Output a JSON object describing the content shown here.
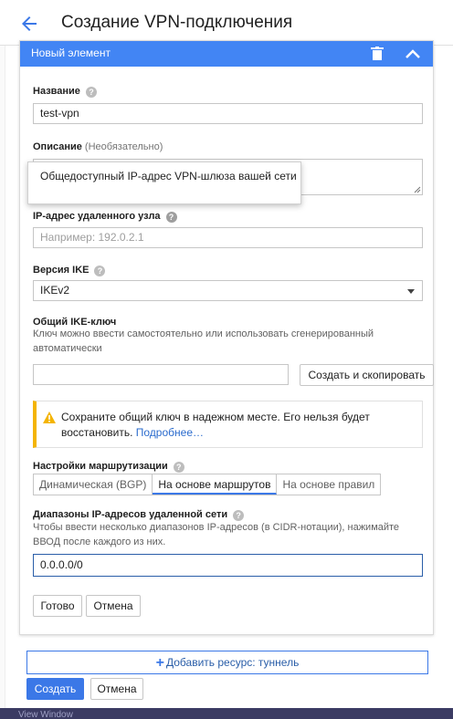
{
  "header": {
    "title": "Создание VPN-подключения"
  },
  "panel": {
    "title": "Новый элемент"
  },
  "fields": {
    "name_label": "Название",
    "name_value": "test-vpn",
    "description_label": "Описание",
    "description_optional": "(Необязательно)",
    "remote_ip_label": "IP-адрес удаленного узла",
    "remote_ip_placeholder": "Например: 192.0.2.1",
    "ike_version_label": "Версия IKE",
    "ike_version_value": "IKEv2",
    "shared_key_label": "Общий IKE-ключ",
    "shared_key_hint": "Ключ можно ввести самостоятельно или использовать сгенерированный автоматически",
    "shared_key_value": "",
    "generate_button": "Создать и скопировать"
  },
  "tooltip": {
    "text": "Общедоступный IP-адрес VPN-шлюза вашей сети"
  },
  "warning": {
    "text": "Сохраните общий ключ в надежном месте. Его нельзя будет восстановить.",
    "link": "Подробнее…"
  },
  "routing": {
    "label": "Настройки маршрутизации",
    "options": [
      "Динамическая (BGP)",
      "На основе маршрутов",
      "На основе правил"
    ],
    "selected": "На основе маршрутов"
  },
  "remote_ranges": {
    "label": "Диапазоны IP-адресов удаленной сети",
    "hint": "Чтобы ввести несколько диапазонов IP-адресов (в CIDR-нотации), нажимайте ВВОД после каждого из них.",
    "value": "0.0.0.0/0"
  },
  "panel_actions": {
    "done": "Готово",
    "cancel": "Отмена"
  },
  "footer": {
    "add_resource": "Добавить ресурс: туннель",
    "create": "Создать",
    "cancel": "Отмена"
  },
  "taskbar": {
    "text": "View    Window"
  },
  "colors": {
    "accent": "#4285f4",
    "primary_button": "#3b78e7",
    "warning": "#f4b400",
    "link": "#2a6bcd"
  }
}
